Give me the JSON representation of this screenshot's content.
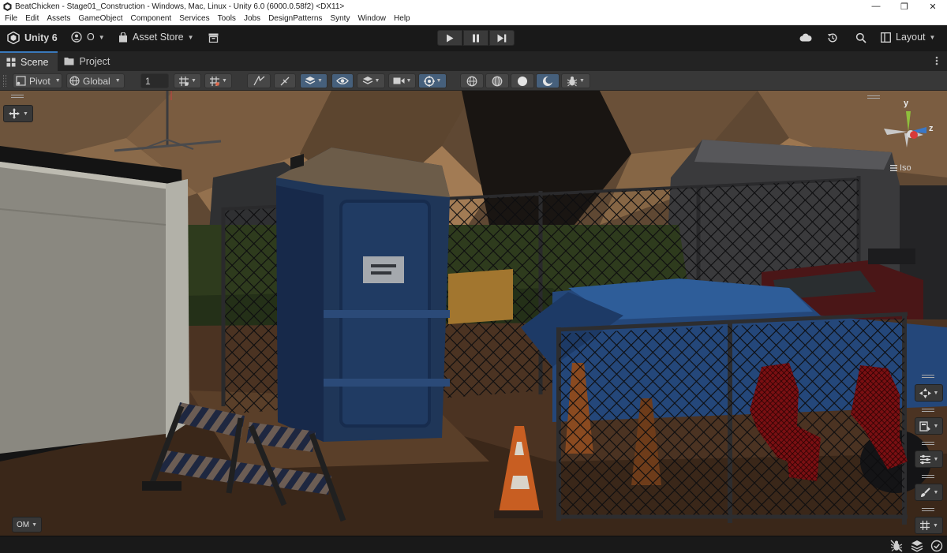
{
  "window": {
    "title": "BeatChicken - Stage01_Construction - Windows, Mac, Linux - Unity 6.0 (6000.0.58f2) <DX11>",
    "min_glyph": "—",
    "max_glyph": "❐",
    "close_glyph": "✕"
  },
  "menu": [
    "File",
    "Edit",
    "Assets",
    "GameObject",
    "Component",
    "Services",
    "Tools",
    "Jobs",
    "DesignPatterns",
    "Synty",
    "Window",
    "Help"
  ],
  "toolbar": {
    "unity_label": "Unity 6",
    "account_label": "O",
    "asset_store_label": "Asset Store",
    "layout_label": "Layout"
  },
  "tabs": [
    {
      "label": "Scene",
      "active": true
    },
    {
      "label": "Project",
      "active": false
    }
  ],
  "scene_toolbar": {
    "pivot_label": "Pivot",
    "global_label": "Global",
    "grid_snap_value": "1"
  },
  "gizmo": {
    "y_label": "y",
    "z_label": "z",
    "projection_label": "Iso"
  },
  "viewport": {
    "overlay_menu_label": "OM"
  },
  "colors": {
    "accent_blue": "#3a79bb",
    "toggle_on": "#46607c",
    "panel": "#383838",
    "toolbar_dark": "#191919"
  }
}
